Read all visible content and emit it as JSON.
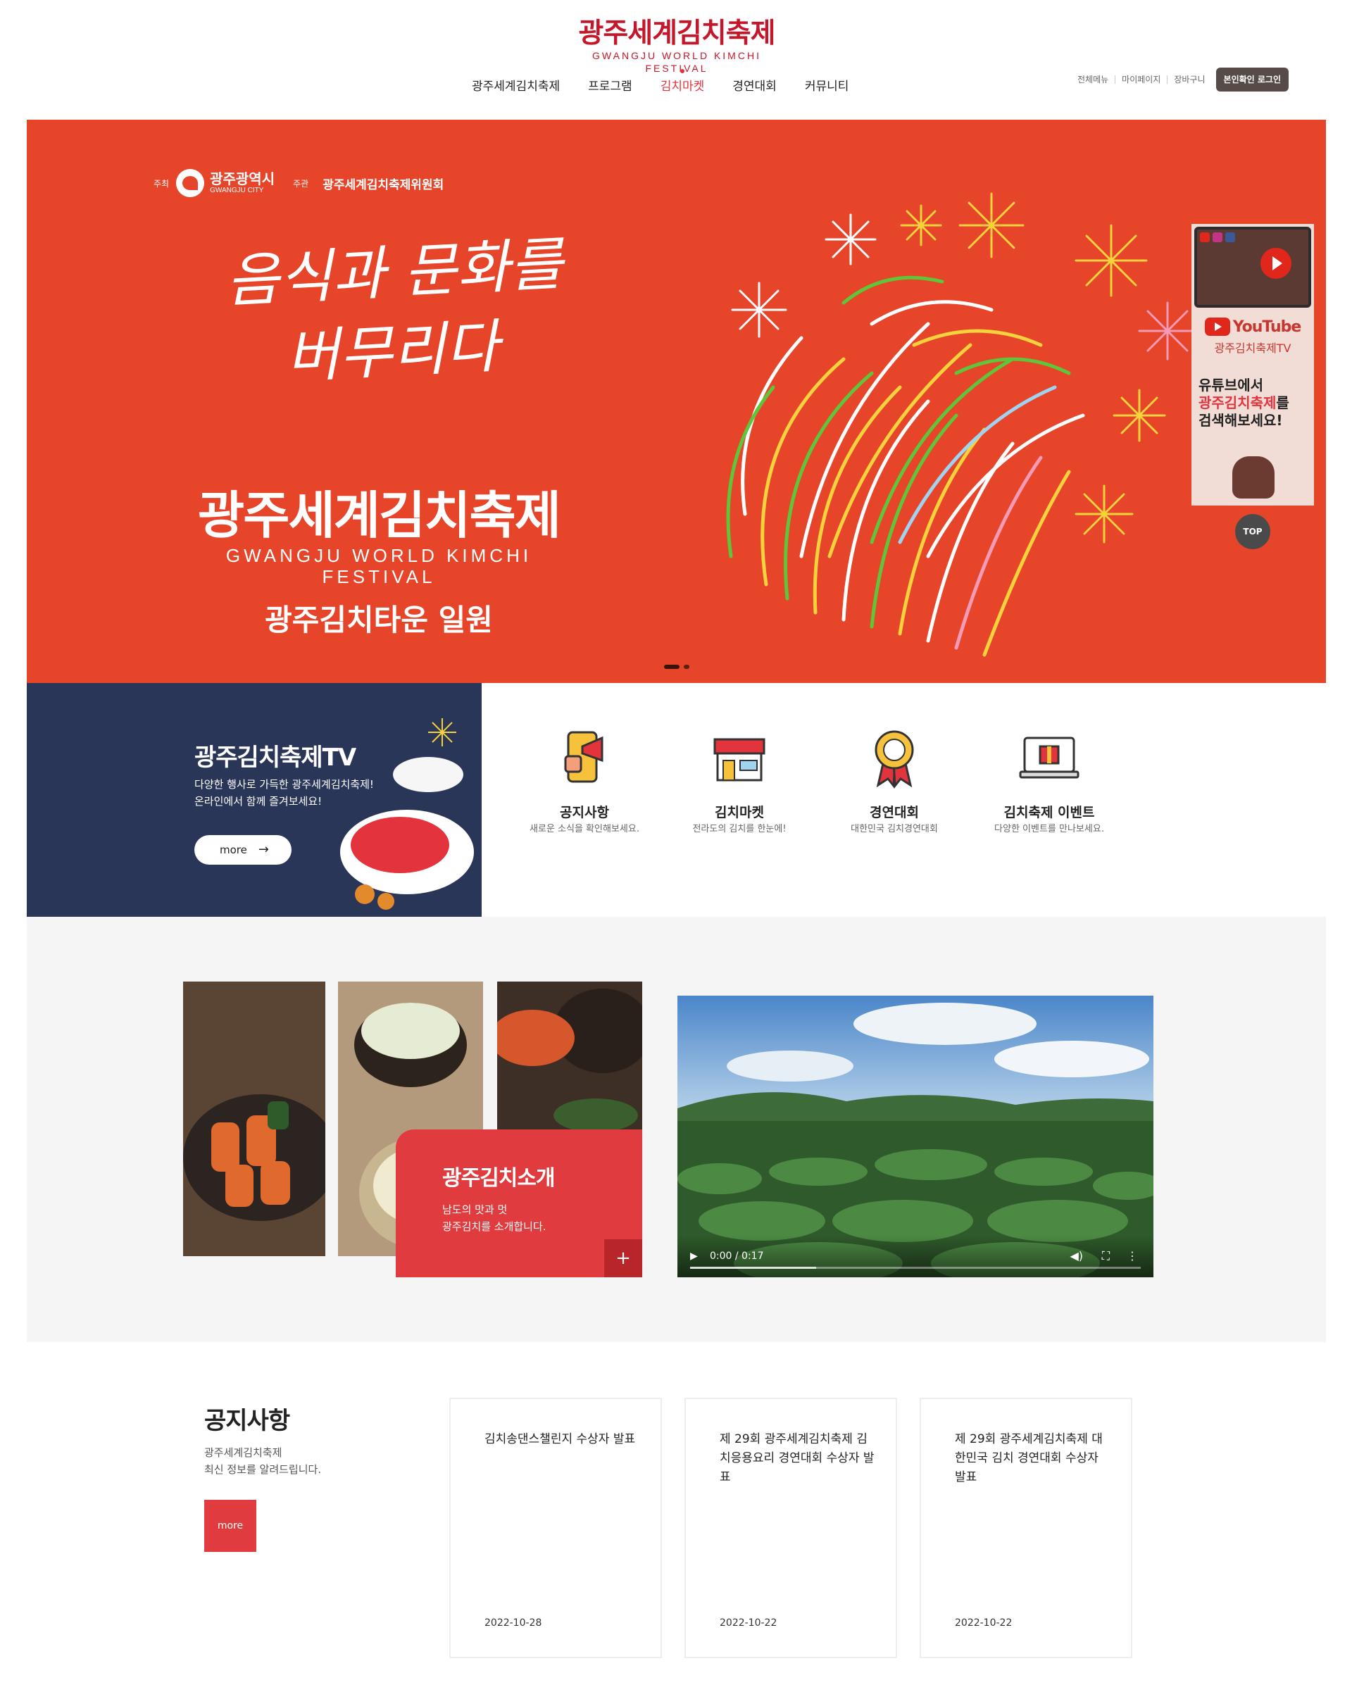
{
  "header": {
    "logo_ko": "광주세계김치축제",
    "logo_en": "GWANGJU WORLD KIMCHI FESTIVAL",
    "nav": [
      "광주세계김치축제",
      "프로그램",
      "김치마켓",
      "경연대회",
      "커뮤니티"
    ],
    "active_nav": "김치마켓",
    "util": [
      "전체메뉴",
      "마이페이지",
      "장바구니"
    ],
    "login": "본인확인 로그인"
  },
  "hero": {
    "host_label": "주최",
    "host_name": "광주광역시",
    "host_en": "GWANGJU CITY",
    "org_label": "주관",
    "org_name": "광주세계김치축제위원회",
    "slogan_line1": "음식과 문화를",
    "slogan_line2": "버무리다",
    "title_ko": "광주세계김치축제",
    "title_en": "GWANGJU WORLD KIMCHI FESTIVAL",
    "subtitle": "광주김치타운 일원",
    "slide_count": 2,
    "active_slide": 1
  },
  "youtube_panel": {
    "logo_word": "YouTube",
    "channel": "광주김치축제TV",
    "line1": "유튜브에서",
    "line2_red": "광주김치축제",
    "line2_tail": "를",
    "line3": "검색해보세요!"
  },
  "top_button": "TOP",
  "tv": {
    "title": "광주김치축제TV",
    "desc_line1": "다양한 행사로 가득한 광주세계김치축제!",
    "desc_line2": "온라인에서 함께 즐겨보세요!",
    "more": "more",
    "arrow": "→"
  },
  "quick_links": [
    {
      "title": "공지사항",
      "desc": "새로운 소식을 확인해보세요.",
      "icon": "megaphone-phone-icon"
    },
    {
      "title": "김치마켓",
      "desc": "전라도의 김치를 한눈에!",
      "icon": "market-store-icon"
    },
    {
      "title": "경연대회",
      "desc": "대한민국 김치경연대회",
      "icon": "award-medal-icon"
    },
    {
      "title": "김치축제 이벤트",
      "desc": "다양한 이벤트를 만나보세요.",
      "icon": "gift-laptop-icon"
    }
  ],
  "intro": {
    "title": "광주김치소개",
    "desc_line1": "남도의 맛과 멋",
    "desc_line2": "광주김치를 소개합니다.",
    "plus": "+"
  },
  "video": {
    "time": "0:00 / 0:17",
    "progress": 0.28
  },
  "notices": {
    "title": "공지사항",
    "desc_line1": "광주세계김치축제",
    "desc_line2": "최신 정보를 알려드립니다.",
    "more": "more",
    "items": [
      {
        "title": "김치송댄스챌린지 수상자 발표",
        "date": "2022-10-28"
      },
      {
        "title": "제 29회 광주세계김치축제 김치응용요리 경연대회 수상자 발표",
        "date": "2022-10-22"
      },
      {
        "title": "제 29회 광주세계김치축제 대한민국 김치 경연대회 수상자 발표",
        "date": "2022-10-22"
      }
    ]
  },
  "colors": {
    "brand_red": "#c5172b",
    "hero_bg": "#e7452a",
    "tv_bg": "#2a3658",
    "accent": "#e03c3f"
  }
}
